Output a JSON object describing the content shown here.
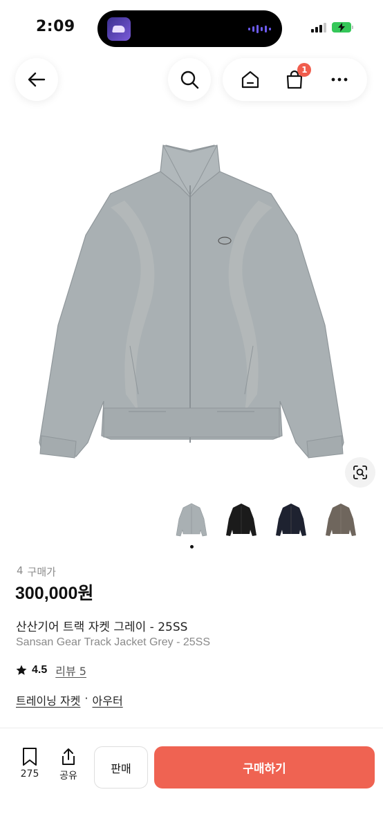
{
  "status": {
    "time": "2:09",
    "battery_color": "#35c759"
  },
  "nav": {
    "back_icon": "arrow-left-icon",
    "search_icon": "search-icon",
    "home_icon": "home-icon",
    "cart_icon": "shopping-bag-icon",
    "cart_count": "1",
    "more_icon": "more-horizontal-icon"
  },
  "product": {
    "buyers_count": "4",
    "buyers_label": "구매가",
    "price": "300,000원",
    "name_ko": "산산기어 트랙 자켓 그레이 - 25SS",
    "name_en": "Sansan Gear Track Jacket Grey - 25SS",
    "rating": "4.5",
    "review_label": "리뷰 5",
    "category_main": "트레이닝 자켓",
    "category_separator": "·",
    "category_sub": "아우터",
    "thumbnails": [
      "grey",
      "black",
      "navy",
      "brown"
    ],
    "thumbnail_colors": [
      "#a9b0b3",
      "#1b1b1b",
      "#1e2230",
      "#6f665d"
    ],
    "main_color": "#a7aeb1"
  },
  "bottom": {
    "save_count": "275",
    "share_label": "공유",
    "sell_label": "판매",
    "buy_label": "구매하기",
    "buy_color": "#ef6352"
  }
}
